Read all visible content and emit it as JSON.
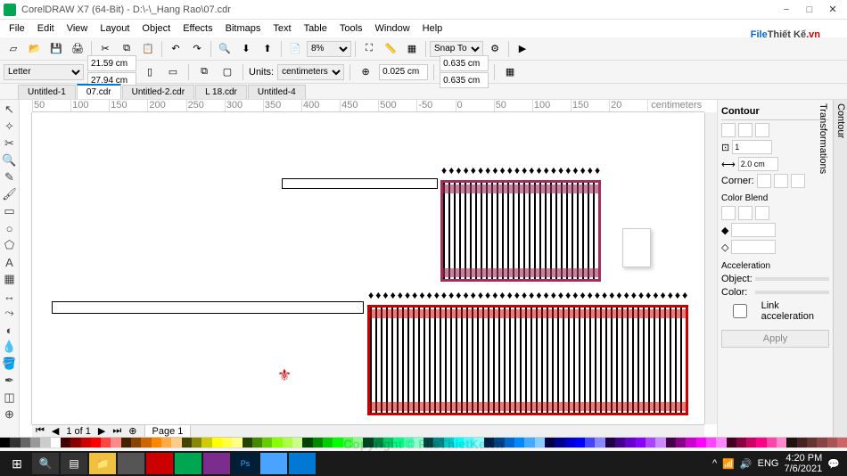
{
  "title": "CorelDRAW X7 (64-Bit) - D:\\-\\_Hang Rao\\07.cdr",
  "menu": [
    "File",
    "Edit",
    "View",
    "Layout",
    "Object",
    "Effects",
    "Bitmaps",
    "Text",
    "Table",
    "Tools",
    "Window",
    "Help"
  ],
  "toolbar1": {
    "zoom": "8%",
    "snap": "Snap To"
  },
  "toolbar2": {
    "pagesize": "Letter",
    "width": "21.59 cm",
    "height": "27.94 cm",
    "units_label": "Units:",
    "units": "centimeters",
    "nudge": "0.025 cm",
    "dup_x": "0.635 cm",
    "dup_y": "0.635 cm"
  },
  "tabs": [
    "Untitled-1",
    "07.cdr",
    "Untitled-2.cdr",
    "L 18.cdr",
    "Untitled-4"
  ],
  "active_tab": 1,
  "ruler_marks": [
    "50",
    "100",
    "150",
    "200",
    "250",
    "300",
    "350",
    "400",
    "450",
    "500",
    "-50",
    "0",
    "50",
    "100",
    "150",
    "20"
  ],
  "ruler_unit": "centimeters",
  "pagebar": {
    "page_of": "1 of 1",
    "page": "Page 1"
  },
  "docker": {
    "title": "Contour",
    "steps": "1",
    "offset": "2.0 cm",
    "corner_label": "Corner:",
    "blend_label": "Color Blend",
    "accel_label": "Acceleration",
    "obj_label": "Object:",
    "color_label": "Color:",
    "link": "Link acceleration",
    "apply": "Apply"
  },
  "docker_tabs": [
    "Contour",
    "Transformations"
  ],
  "status": {
    "cursor": "✕",
    "fill_label": "◇",
    "outline_label": "◆"
  },
  "watermark": "Copyright © FileThietKe.vn",
  "brand": {
    "p1": "File",
    "p2": "Thiết Kế",
    "p3": ".vn"
  },
  "taskbar": {
    "lang": "ENG",
    "time": "4:20 PM",
    "date": "7/6/2021"
  },
  "colors": [
    "#000",
    "#333",
    "#666",
    "#999",
    "#ccc",
    "#fff",
    "#400",
    "#800",
    "#c00",
    "#f00",
    "#f44",
    "#f88",
    "#420",
    "#840",
    "#c60",
    "#f80",
    "#fa4",
    "#fc8",
    "#440",
    "#880",
    "#cc0",
    "#ff0",
    "#ff4",
    "#ff8",
    "#240",
    "#480",
    "#6c0",
    "#8f0",
    "#af4",
    "#cf8",
    "#040",
    "#080",
    "#0c0",
    "#0f0",
    "#4f4",
    "#8f8",
    "#042",
    "#084",
    "#0c6",
    "#0f8",
    "#4fa",
    "#8fc",
    "#044",
    "#088",
    "#0cc",
    "#0ff",
    "#4ff",
    "#8ff",
    "#024",
    "#048",
    "#06c",
    "#08f",
    "#4af",
    "#8cf",
    "#004",
    "#008",
    "#00c",
    "#00f",
    "#44f",
    "#88f",
    "#204",
    "#408",
    "#60c",
    "#80f",
    "#a4f",
    "#c8f",
    "#404",
    "#808",
    "#c0c",
    "#f0f",
    "#f4f",
    "#f8f",
    "#402",
    "#804",
    "#c06",
    "#f08",
    "#f4a",
    "#f8c",
    "#211",
    "#422",
    "#633",
    "#844",
    "#a55",
    "#c66"
  ]
}
